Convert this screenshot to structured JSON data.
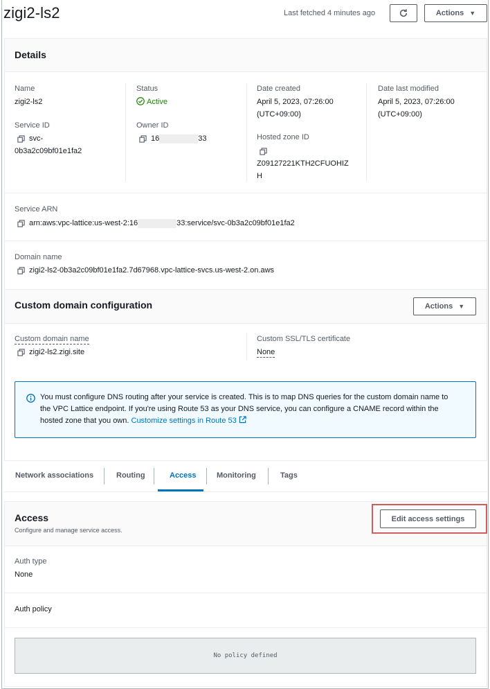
{
  "header": {
    "title": "zigi2-ls2",
    "last_fetched": "Last fetched 4 minutes ago",
    "actions_label": "Actions"
  },
  "details": {
    "title": "Details",
    "name_label": "Name",
    "name_value": "zigi2-ls2",
    "status_label": "Status",
    "status_value": "Active",
    "date_created_label": "Date created",
    "date_created_line1": "April 5, 2023, 07:26:00",
    "date_created_line2": "(UTC+09:00)",
    "date_modified_label": "Date last modified",
    "date_modified_line1": "April 5, 2023, 07:26:00",
    "date_modified_line2": "(UTC+09:00)",
    "service_id_label": "Service ID",
    "service_id_line1": "svc-",
    "service_id_line2": "0b3a2c09bf01e1fa2",
    "owner_id_label": "Owner ID",
    "owner_id_prefix": "16",
    "owner_id_suffix": "33",
    "hosted_zone_label": "Hosted zone ID",
    "hosted_zone_line1": "Z09127221KTH2CFUOHIZ",
    "hosted_zone_line2": "H",
    "arn_label": "Service ARN",
    "arn_prefix": "arn:aws:vpc-lattice:us-west-2:16",
    "arn_suffix": "33:service/svc-0b3a2c09bf01e1fa2",
    "domain_label": "Domain name",
    "domain_value": "zigi2-ls2-0b3a2c09bf01e1fa2.7d67968.vpc-lattice-svcs.us-west-2.on.aws"
  },
  "custom_domain": {
    "title": "Custom domain configuration",
    "actions_label": "Actions",
    "name_label": "Custom domain name",
    "name_value": "zigi2-ls2.zigi.site",
    "cert_label": "Custom SSL/TLS certificate",
    "cert_value": "None",
    "info_line1": "You must configure DNS routing after your service is created. This is to map DNS queries for the custom domain name to",
    "info_line2": "the VPC Lattice endpoint. If you're using Route 53 as your DNS service, you can configure a CNAME record within the",
    "info_line3": "hosted zone that you own.",
    "info_link": "Customize settings in Route 53"
  },
  "tabs": [
    {
      "label": "Network associations"
    },
    {
      "label": "Routing"
    },
    {
      "label": "Access"
    },
    {
      "label": "Monitoring"
    },
    {
      "label": "Tags"
    }
  ],
  "access": {
    "title": "Access",
    "subtitle": "Configure and manage service access.",
    "edit_label": "Edit access settings",
    "auth_type_label": "Auth type",
    "auth_type_value": "None",
    "auth_policy_label": "Auth policy",
    "policy_placeholder": "No policy defined"
  },
  "colors": {
    "accent": "#0073bb",
    "active": "#1d8102",
    "highlight": "#d45b5b"
  }
}
